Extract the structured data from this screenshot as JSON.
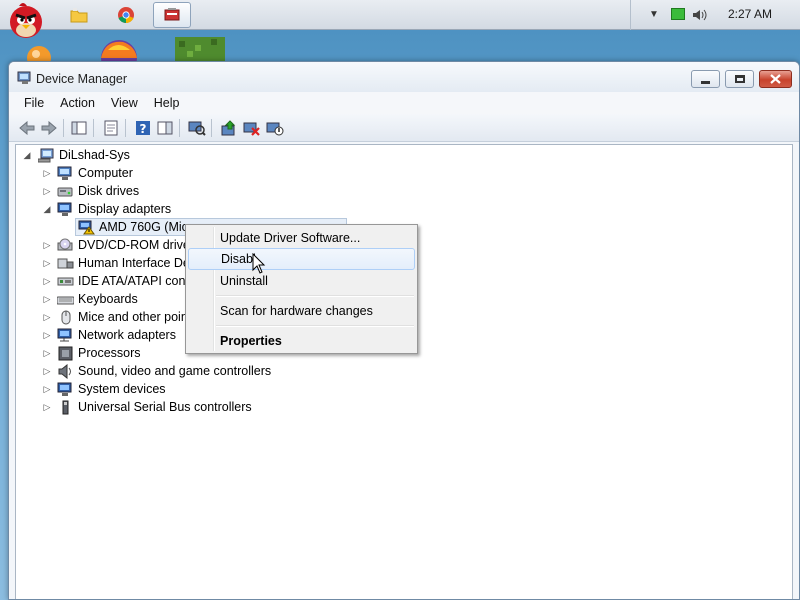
{
  "taskbar": {
    "clock": "2:27 AM",
    "apps": [
      "angry-birds",
      "file-explorer",
      "chrome",
      "device-manager"
    ]
  },
  "window": {
    "title": "Device Manager",
    "menu": [
      "File",
      "Action",
      "View",
      "Help"
    ]
  },
  "tree": {
    "root": "DiLshad-Sys",
    "items": [
      {
        "label": "Computer",
        "icon": "computer-icon",
        "expanded": false
      },
      {
        "label": "Disk drives",
        "icon": "disk-drive-icon",
        "expanded": false
      },
      {
        "label": "Display adapters",
        "icon": "display-adapter-icon",
        "expanded": true
      },
      {
        "label": "DVD/CD-ROM drives",
        "icon": "dvd-drive-icon",
        "expanded": false
      },
      {
        "label": "Human Interface Dev",
        "icon": "hid-icon",
        "expanded": false
      },
      {
        "label": "IDE ATA/ATAPI cont",
        "icon": "ide-controller-icon",
        "expanded": false
      },
      {
        "label": "Keyboards",
        "icon": "keyboard-icon",
        "expanded": false
      },
      {
        "label": "Mice and other point",
        "icon": "mouse-icon",
        "expanded": false
      },
      {
        "label": "Network adapters",
        "icon": "network-adapter-icon",
        "expanded": false
      },
      {
        "label": "Processors",
        "icon": "processor-icon",
        "expanded": false
      },
      {
        "label": "Sound, video and game controllers",
        "icon": "sound-icon",
        "expanded": false
      },
      {
        "label": "System devices",
        "icon": "system-devices-icon",
        "expanded": false
      },
      {
        "label": "Universal Serial Bus controllers",
        "icon": "usb-icon",
        "expanded": false
      }
    ],
    "child_device": "AMD 760G (Micro"
  },
  "context_menu": {
    "items": [
      "Update Driver Software...",
      "Disabl",
      "Uninstall",
      "Scan for hardware changes",
      "Properties"
    ]
  },
  "colors": {
    "selection": "#e6eef8",
    "menu_hover_border": "#aecff7",
    "close_button": "#c8432d"
  }
}
